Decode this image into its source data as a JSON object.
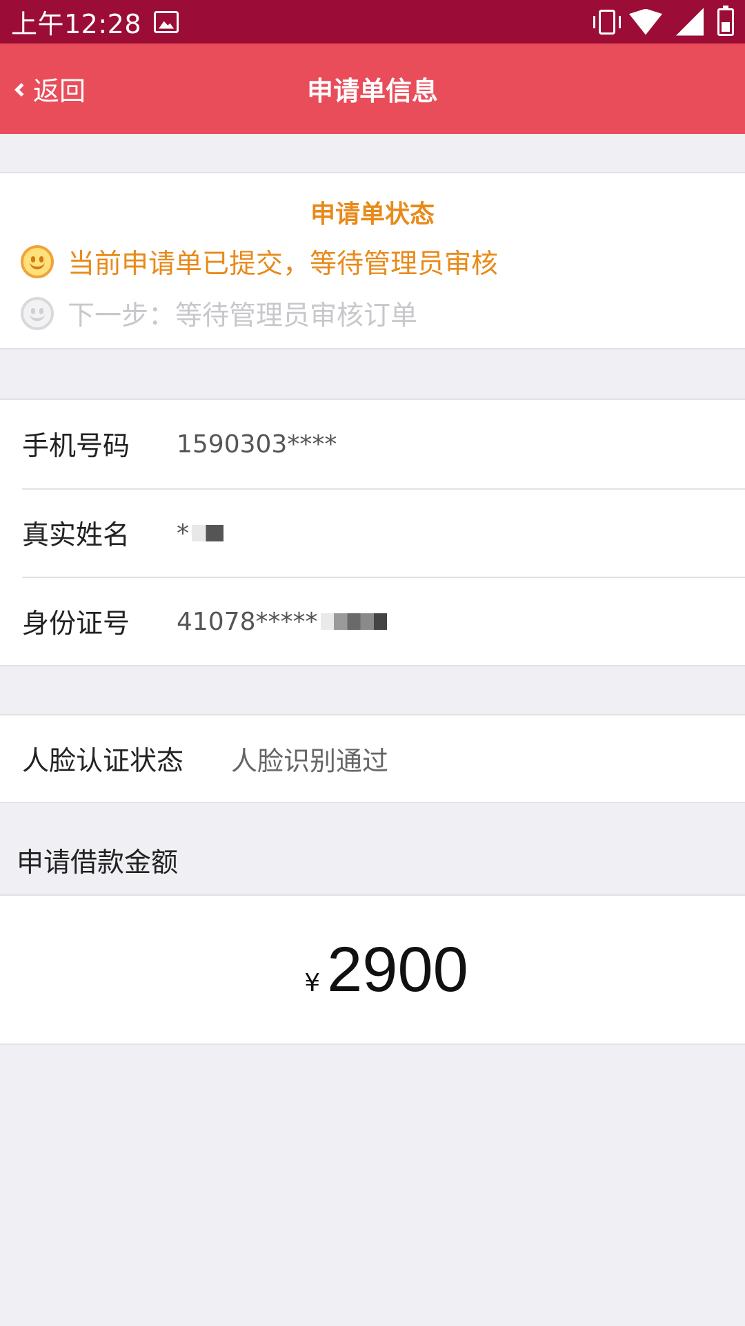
{
  "status_bar": {
    "time": "上午12:28",
    "icons": [
      "gallery-icon",
      "vibrate-icon",
      "wifi-icon",
      "signal-icon",
      "battery-icon"
    ]
  },
  "nav": {
    "back_label": "返回",
    "title": "申请单信息"
  },
  "application_status": {
    "title": "申请单状态",
    "current": "当前申请单已提交，等待管理员审核",
    "next": "下一步：等待管理员审核订单"
  },
  "info": {
    "phone": {
      "label": "手机号码",
      "value": "1590303****"
    },
    "name": {
      "label": "真实姓名",
      "value": "*"
    },
    "id_number": {
      "label": "身份证号",
      "value": "41078*****"
    }
  },
  "face_auth": {
    "label": "人脸认证状态",
    "value": "人脸识别通过"
  },
  "loan": {
    "header": "申请借款金额",
    "currency": "¥",
    "amount": "2900"
  },
  "colors": {
    "status_bar": "#9b0d37",
    "nav_bar": "#e94d5a",
    "accent_orange": "#e88a1a",
    "background": "#efeff4"
  }
}
